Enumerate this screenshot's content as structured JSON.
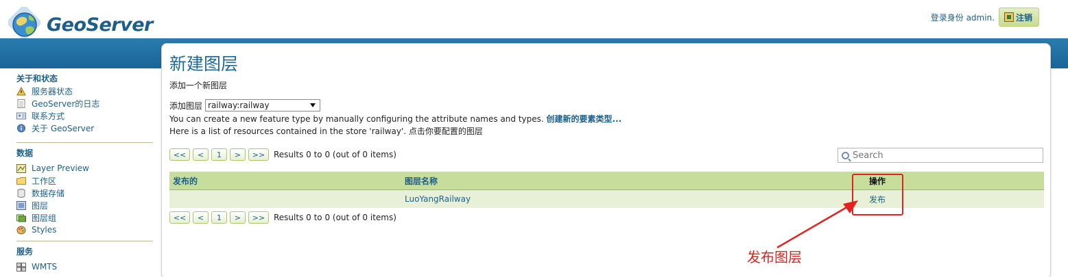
{
  "header": {
    "logo_text": "GeoServer",
    "user_label": "登录身份 admin.",
    "logout_label": "注销"
  },
  "sidebar": {
    "sections": [
      {
        "title": "关于和状态",
        "items": [
          {
            "label": "服务器状态",
            "icon": "server-status-icon"
          },
          {
            "label": "GeoServer的日志",
            "icon": "log-icon"
          },
          {
            "label": "联系方式",
            "icon": "contact-icon"
          },
          {
            "label": "关于 GeoServer",
            "icon": "about-icon"
          }
        ]
      },
      {
        "title": "数据",
        "items": [
          {
            "label": "Layer Preview",
            "icon": "layer-preview-icon"
          },
          {
            "label": "工作区",
            "icon": "workspace-icon"
          },
          {
            "label": "数据存储",
            "icon": "datastore-icon"
          },
          {
            "label": "图层",
            "icon": "layer-icon"
          },
          {
            "label": "图层组",
            "icon": "layer-group-icon"
          },
          {
            "label": "Styles",
            "icon": "styles-icon"
          }
        ]
      },
      {
        "title": "服务",
        "items": [
          {
            "label": "WMTS",
            "icon": "wmts-icon"
          }
        ]
      }
    ]
  },
  "main": {
    "title": "新建图层",
    "subtitle": "添加一个新图层",
    "add_layer_label": "添加图层",
    "add_layer_selected": "railway:railway",
    "info_text": "You can create a new feature type by manually configuring the attribute names and types.",
    "create_link": "创建新的要素类型...",
    "store_info": "Here is a list of resources contained in the store 'railway'. 点击你要配置的图层",
    "pager": {
      "first": "<<",
      "prev": "<",
      "page": "1",
      "next": ">",
      "last": ">>",
      "results": "Results 0 to 0 (out of 0 items)"
    },
    "search_placeholder": "Search",
    "table": {
      "headers": [
        "发布的",
        "图层名称",
        "操作"
      ],
      "rows": [
        {
          "published": "",
          "name": "LuoYangRailway",
          "action": "发布"
        }
      ]
    }
  },
  "annotation": {
    "label": "发布图层",
    "color": "#e4211f"
  }
}
